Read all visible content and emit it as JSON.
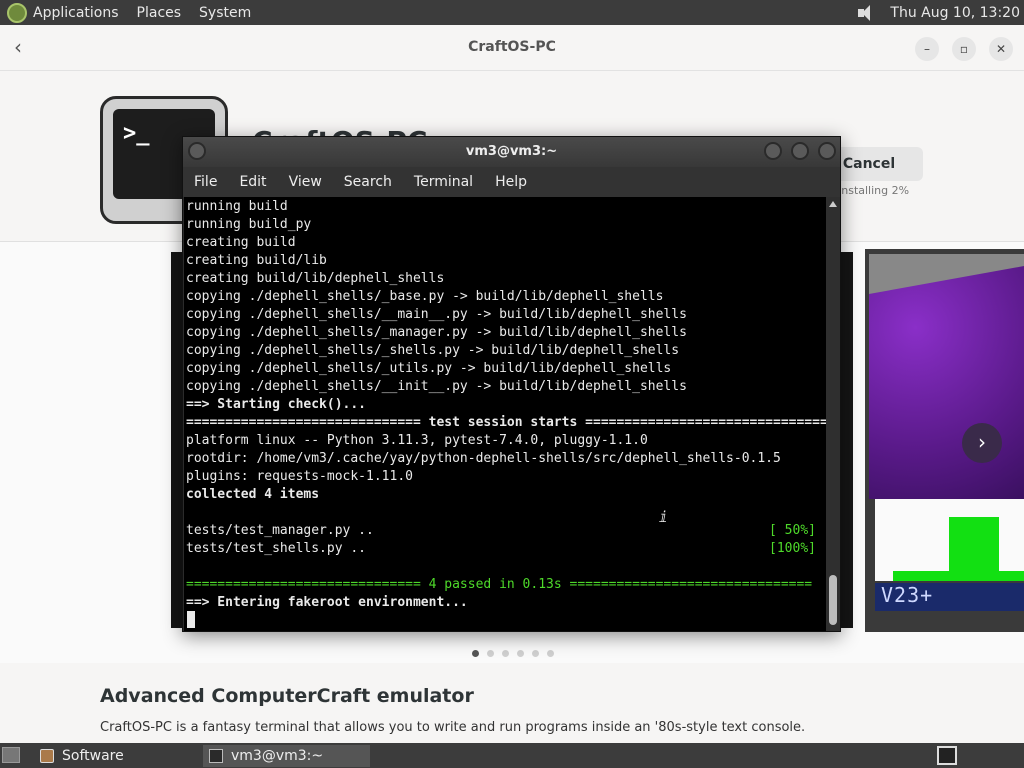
{
  "top_panel": {
    "menus": [
      "Applications",
      "Places",
      "System"
    ],
    "clock": "Thu Aug 10, 13:20"
  },
  "software_app": {
    "window_title": "CraftOS-PC",
    "back_icon": "back-chevron-icon",
    "app_name": "CraftOS-PC",
    "cancel_label": "Cancel",
    "install_status": "Installing 2%",
    "screenshot_text": "V23+",
    "gallery_dots": 6,
    "gallery_active_index": 0,
    "description_title": "Advanced ComputerCraft emulator",
    "description_text": "CraftOS-PC is a fantasy terminal that allows you to write and run programs inside an '80s-style text console."
  },
  "terminal": {
    "title": "vm3@vm3:~",
    "menu": [
      "File",
      "Edit",
      "View",
      "Search",
      "Terminal",
      "Help"
    ],
    "lines": [
      "running build",
      "running build_py",
      "creating build",
      "creating build/lib",
      "creating build/lib/dephell_shells",
      "copying ./dephell_shells/_base.py -> build/lib/dephell_shells",
      "copying ./dephell_shells/__main__.py -> build/lib/dephell_shells",
      "copying ./dephell_shells/_manager.py -> build/lib/dephell_shells",
      "copying ./dephell_shells/_shells.py -> build/lib/dephell_shells",
      "copying ./dephell_shells/_utils.py -> build/lib/dephell_shells",
      "copying ./dephell_shells/__init__.py -> build/lib/dephell_shells",
      "==> Starting check()...",
      "============================== test session starts ===============================",
      "platform linux -- Python 3.11.3, pytest-7.4.0, pluggy-1.1.0",
      "rootdir: /home/vm3/.cache/yay/python-dephell-shells/src/dephell_shells-0.1.5",
      "plugins: requests-mock-1.11.0",
      "collected 4 items",
      "",
      "tests/test_manager.py ..",
      "tests/test_shells.py ..",
      "",
      "============================== 4 passed in 0.13s ===============================",
      "==> Entering fakeroot environment..."
    ],
    "test_percent_1": "[ 50%]",
    "test_percent_2": "[100%]"
  },
  "taskbar": {
    "tasks": [
      "Software",
      "vm3@vm3:~"
    ]
  },
  "colors": {
    "panel_bg": "#3c3c3c",
    "terminal_bg": "#000000",
    "terminal_green": "#4ed92a",
    "app_bg": "#fafafa"
  }
}
